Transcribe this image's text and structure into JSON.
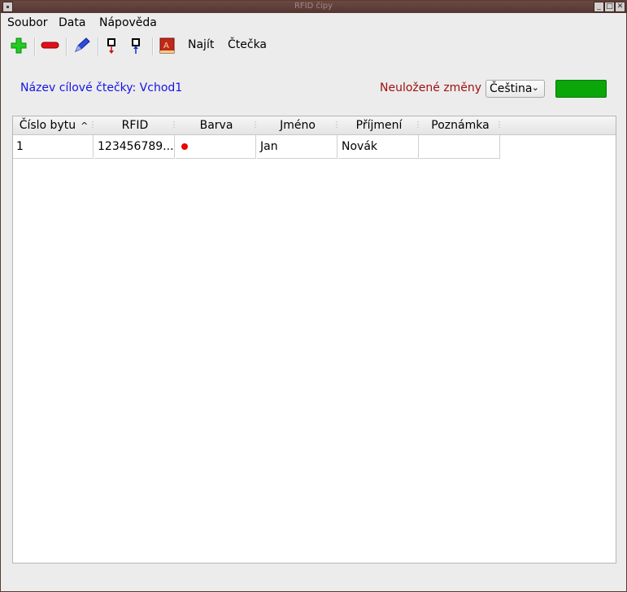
{
  "window": {
    "title": "RFID čipy"
  },
  "menu": {
    "items": [
      "Soubor",
      "Data",
      "Nápověda"
    ]
  },
  "toolbar": {
    "find_label": "Najít",
    "reader_label": "Čtečka",
    "icons": [
      "add-icon",
      "remove-icon",
      "edit-icon",
      "import-icon",
      "export-icon",
      "book-icon"
    ]
  },
  "header": {
    "reader_name": "Název cílové čtečky: Vchod1",
    "unsaved": "Neuložené změny",
    "language": "Čeština",
    "status_color": "#0aa60a"
  },
  "table": {
    "columns": [
      "Číslo bytu",
      "RFID",
      "Barva",
      "Jméno",
      "Příjmení",
      "Poznámka"
    ],
    "sorted_column": "Číslo bytu",
    "rows": [
      {
        "apt": "1",
        "rfid": "123456789...",
        "color": "#ee0000",
        "first": "Jan",
        "last": "Novák",
        "note": ""
      }
    ]
  }
}
